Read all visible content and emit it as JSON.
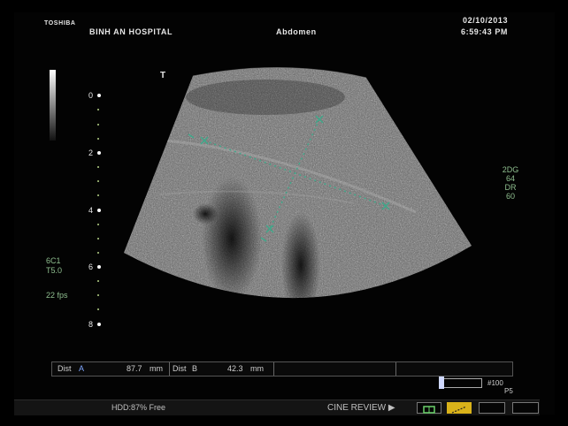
{
  "header": {
    "manufacturer": "TOSHIBA",
    "hospital": "BINH AN HOSPITAL",
    "exam": "Abdomen",
    "date": "02/10/2013",
    "time": "6:59:43 PM",
    "orientation_marker": "T"
  },
  "depth_scale": [
    "0",
    "2",
    "4",
    "6",
    "8"
  ],
  "left_info": {
    "probe": "6C1",
    "freq": "T5.0",
    "fps": "22 fps"
  },
  "right_info": {
    "mode": "2DG",
    "gain": "64",
    "dr_label": "DR",
    "dr_value": "60"
  },
  "measurements": {
    "a_label": "Dist",
    "a_marker": "A",
    "a_value": "87.7",
    "a_unit": "mm",
    "b_label": "Dist",
    "b_marker": "B",
    "b_value": "42.3",
    "b_unit": "mm"
  },
  "cine": {
    "frame_label": "#100",
    "sub_label": "P5"
  },
  "status_bar": {
    "hdd": "HDD:87% Free",
    "cine_review": "CINE REVIEW ▶"
  },
  "colors": {
    "caliper": "#3fa88a",
    "info_green": "#8fbf8f",
    "accent_yellow": "#d9b21a"
  }
}
